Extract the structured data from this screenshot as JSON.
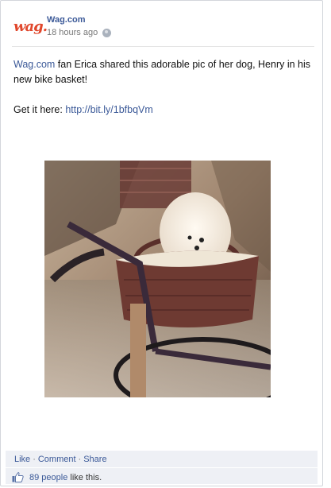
{
  "post": {
    "page_name": "Wag.com",
    "logo_text": "wag.",
    "timestamp": "18 hours ago",
    "text_link": "Wag.com",
    "text_after_link": " fan Erica shared this adorable pic of her dog, Henry in his new bike basket!",
    "get_it_label": "Get it here: ",
    "url": "http://bit.ly/1bfbqVm"
  },
  "actions": {
    "like": "Like",
    "comment": "Comment",
    "share": "Share",
    "separator": "·"
  },
  "likes": {
    "count_text": "89 people",
    "suffix": " like this."
  },
  "colors": {
    "link": "#3b5998",
    "logo": "#e0462b",
    "footer_bg": "#eef0f5"
  },
  "icons": {
    "privacy": "globe-icon",
    "like": "thumbs-up-icon"
  }
}
